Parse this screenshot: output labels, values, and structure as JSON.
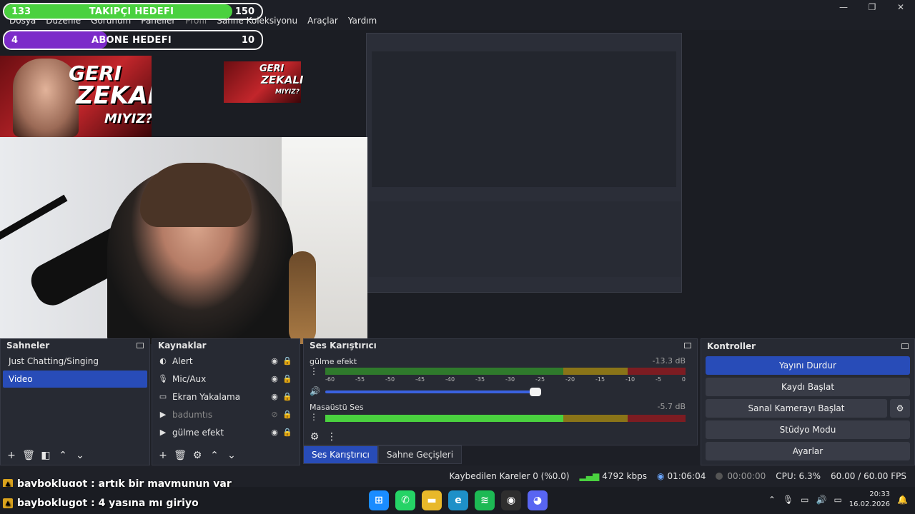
{
  "window_controls": {
    "minimize": "—",
    "maximize": "❐",
    "close": "✕"
  },
  "menu": [
    "Dosya",
    "Düzenle",
    "Görünüm",
    "Paneller",
    "Profil",
    "Sahne Koleksiyonu",
    "Araçlar",
    "Yardım"
  ],
  "goals": {
    "follower": {
      "current": "133",
      "label": "TAKIPÇI HEDEFI",
      "target": "150",
      "progress": 0.887,
      "color": "#4ad13f"
    },
    "subscriber": {
      "current": "4",
      "label": "ABONE HEDEFI",
      "target": "10",
      "progress": 0.4,
      "color": "#7c2bc9"
    }
  },
  "thumbnail": {
    "line1": "GERI",
    "line2": "ZEKALI",
    "line3": "MIYIZ?"
  },
  "scenes": {
    "title": "Sahneler",
    "items": [
      {
        "label": "Just Chatting/Singing",
        "active": false
      },
      {
        "label": "Video",
        "active": true
      }
    ]
  },
  "sources": {
    "title": "Kaynaklar",
    "items": [
      {
        "label": "Alert",
        "icon": "globe-icon",
        "glyph": "◐",
        "visible": true
      },
      {
        "label": "Mic/Aux",
        "icon": "mic-icon",
        "glyph": "🎙",
        "visible": true
      },
      {
        "label": "Ekran Yakalama",
        "icon": "monitor-icon",
        "glyph": "▭",
        "visible": true
      },
      {
        "label": "badumtıs",
        "icon": "play-icon",
        "glyph": "▶",
        "visible": false
      },
      {
        "label": "gülme efekt",
        "icon": "play-icon",
        "glyph": "▶",
        "visible": true
      }
    ]
  },
  "mixer": {
    "title": "Ses Karıştırıcı",
    "ticks": [
      "-60",
      "-55",
      "-50",
      "-45",
      "-40",
      "-35",
      "-30",
      "-25",
      "-20",
      "-15",
      "-10",
      "-5",
      "0"
    ],
    "channels": [
      {
        "name": "gülme efekt",
        "db": "-13.3 dB"
      },
      {
        "name": "Masaüstü Ses",
        "db": "-5.7 dB"
      }
    ]
  },
  "tabs": [
    {
      "label": "Ses Karıştırıcı",
      "active": true
    },
    {
      "label": "Sahne Geçişleri",
      "active": false
    }
  ],
  "controls": {
    "title": "Kontroller",
    "stop_stream": "Yayını Durdur",
    "start_record": "Kaydı Başlat",
    "virtual_cam": "Sanal Kamerayı Başlat",
    "studio_mode": "Stüdyo Modu",
    "settings": "Ayarlar"
  },
  "status": {
    "dropped": "Kaybedilen Kareler 0 (%0.0)",
    "bitrate": "4792 kbps",
    "live_time": "01:06:04",
    "rec_time": "00:00:00",
    "cpu": "CPU: 6.3%",
    "fps": "60.00 / 60.00 FPS"
  },
  "chat": [
    {
      "user": "bayboklugot",
      "message": ": artık bir maymunun var"
    },
    {
      "user": "bayboklugot",
      "message": ": 4 yasına mı giriyo"
    }
  ],
  "taskbar": {
    "apps": [
      {
        "name": "windows-start-icon",
        "glyph": "⊞",
        "color": "#1a8cff"
      },
      {
        "name": "whatsapp-icon",
        "glyph": "✆",
        "color": "#25d366"
      },
      {
        "name": "file-explorer-icon",
        "glyph": "▬",
        "color": "#e8b82a"
      },
      {
        "name": "edge-icon",
        "glyph": "e",
        "color": "#1e90c8"
      },
      {
        "name": "spotify-icon",
        "glyph": "≋",
        "color": "#1db954"
      },
      {
        "name": "obs-icon",
        "glyph": "◉",
        "color": "#2e2e2e"
      },
      {
        "name": "discord-icon",
        "glyph": "◕",
        "color": "#5865f2"
      }
    ],
    "time": "20:33",
    "date": "16.02.2026"
  }
}
